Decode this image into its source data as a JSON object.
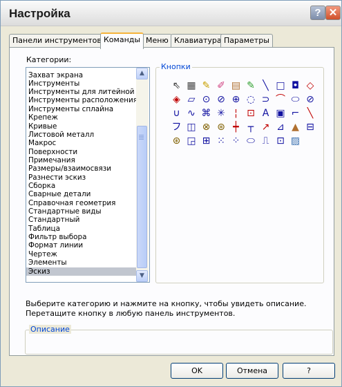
{
  "window": {
    "title": "Настройка",
    "help_button": "?",
    "close_button": "✕"
  },
  "tabs": [
    {
      "label": "Панели инструментов"
    },
    {
      "label": "Команды",
      "active": true
    },
    {
      "label": "Меню"
    },
    {
      "label": "Клавиатура"
    },
    {
      "label": "Параметры"
    }
  ],
  "categories": {
    "label": "Категории:",
    "items": [
      "Захват экрана",
      "Инструменты",
      "Инструменты для литейной ф",
      "Инструменты расположения",
      "Инструменты сплайна",
      "Крепеж",
      "Кривые",
      "Листовой металл",
      "Макрос",
      "Поверхности",
      "Примечания",
      "Размеры/взаимосвязи",
      "Разнести эскиз",
      "Сборка",
      "Сварные детали",
      "Справочная геометрия",
      "Стандартные виды",
      "Стандартный",
      "Таблица",
      "Фильтр выбора",
      "Формат линии",
      "Чертеж",
      "Элементы",
      "Эскиз"
    ],
    "selected": "Эскиз"
  },
  "buttons_group": {
    "legend": "Кнопки",
    "tools": [
      {
        "icon": "pointer-icon",
        "glyph": "⇖",
        "color": "#333333"
      },
      {
        "icon": "grid-icon",
        "glyph": "▦",
        "color": "#444444"
      },
      {
        "icon": "sketch-icon",
        "glyph": "✎",
        "color": "#c8a000"
      },
      {
        "icon": "3d-sketch-icon",
        "glyph": "✐",
        "color": "#d04080"
      },
      {
        "icon": "sketch-picture-icon",
        "glyph": "▤",
        "color": "#b07030"
      },
      {
        "icon": "edit-sketch-icon",
        "glyph": "✎",
        "color": "#30a030"
      },
      {
        "icon": "line-icon",
        "glyph": "╲",
        "color": "#1010a0"
      },
      {
        "icon": "rectangle-icon",
        "glyph": "□",
        "color": "#1010a0"
      },
      {
        "icon": "center-rectangle-icon",
        "glyph": "◘",
        "color": "#1010a0"
      },
      {
        "icon": "diamond-icon",
        "glyph": "◇",
        "color": "#c00000"
      },
      {
        "icon": "polygon-icon",
        "glyph": "◈",
        "color": "#c00000"
      },
      {
        "icon": "parallelogram-icon",
        "glyph": "▱",
        "color": "#1010a0"
      },
      {
        "icon": "circle-icon",
        "glyph": "⊙",
        "color": "#1010a0"
      },
      {
        "icon": "perimeter-circle-icon",
        "glyph": "⊘",
        "color": "#1010a0"
      },
      {
        "icon": "center-arc-icon",
        "glyph": "⊕",
        "color": "#1010a0"
      },
      {
        "icon": "tangent-arc-icon",
        "glyph": "◌",
        "color": "#1010a0"
      },
      {
        "icon": "three-point-arc-icon",
        "glyph": "⊃",
        "color": "#1010a0"
      },
      {
        "icon": "sagittal-arc-icon",
        "glyph": "⌒",
        "color": "#c00000"
      },
      {
        "icon": "ellipse-icon",
        "glyph": "⬭",
        "color": "#1010a0"
      },
      {
        "icon": "partial-ellipse-icon",
        "glyph": "⊘",
        "color": "#1010a0"
      },
      {
        "icon": "parabola-icon",
        "glyph": "∪",
        "color": "#1010a0"
      },
      {
        "icon": "spline-icon",
        "glyph": "∿",
        "color": "#1010a0"
      },
      {
        "icon": "spline-on-surface-icon",
        "glyph": "⌘",
        "color": "#1010a0"
      },
      {
        "icon": "point-icon",
        "glyph": "✳",
        "color": "#1010a0"
      },
      {
        "icon": "centerline-icon",
        "glyph": "¦",
        "color": "#c00000"
      },
      {
        "icon": "linear-pattern-icon",
        "glyph": "⊡",
        "color": "#c00000"
      },
      {
        "icon": "text-icon",
        "glyph": "A",
        "color": "#1010a0"
      },
      {
        "icon": "plane-icon",
        "glyph": "▣",
        "color": "#1010a0"
      },
      {
        "icon": "fillet-icon",
        "glyph": "⌐",
        "color": "#1010a0"
      },
      {
        "icon": "chamfer-icon",
        "glyph": "╲",
        "color": "#c00000"
      },
      {
        "icon": "offset-icon",
        "glyph": "フ",
        "color": "#1010a0"
      },
      {
        "icon": "convert-entities-icon",
        "glyph": "◫",
        "color": "#1010a0"
      },
      {
        "icon": "intersection-curve-icon",
        "glyph": "⊗",
        "color": "#806000"
      },
      {
        "icon": "face-curves-icon",
        "glyph": "⊛",
        "color": "#806000"
      },
      {
        "icon": "trim-icon",
        "glyph": "┿",
        "color": "#c00000"
      },
      {
        "icon": "extend-icon",
        "glyph": "┬",
        "color": "#1010a0"
      },
      {
        "icon": "split-icon",
        "glyph": "↗",
        "color": "#c00000"
      },
      {
        "icon": "jog-line-icon",
        "glyph": "⊿",
        "color": "#1010a0"
      },
      {
        "icon": "construction-geometry-icon",
        "glyph": "▲",
        "color": "#b07030"
      },
      {
        "icon": "mirror-icon",
        "glyph": "⊟",
        "color": "#1010a0"
      },
      {
        "icon": "dynamic-mirror-icon",
        "glyph": "⊛",
        "color": "#806000"
      },
      {
        "icon": "stretch-icon",
        "glyph": "◲",
        "color": "#1010a0"
      },
      {
        "icon": "move-icon",
        "glyph": "⊞",
        "color": "#1010a0"
      },
      {
        "icon": "linear-array-icon",
        "glyph": "⁙",
        "color": "#1010a0"
      },
      {
        "icon": "circular-array-icon",
        "glyph": "⁘",
        "color": "#1010a0"
      },
      {
        "icon": "slot-icon",
        "glyph": "⬭",
        "color": "#1010a0"
      },
      {
        "icon": "modify-icon",
        "glyph": "⎍",
        "color": "#1010a0"
      },
      {
        "icon": "linear-pattern-2-icon",
        "glyph": "⊡",
        "color": "#1010a0"
      },
      {
        "icon": "sketch-image-icon",
        "glyph": "▨",
        "color": "#3a70b0"
      }
    ]
  },
  "hint_text": "Выберите категорию и нажмите на кнопку, чтобы увидеть описание. Перетащите кнопку в любую панель инструментов.",
  "description_group": {
    "legend": "Описание"
  },
  "footer": {
    "ok": "OK",
    "cancel": "Отмена",
    "help": "?"
  }
}
